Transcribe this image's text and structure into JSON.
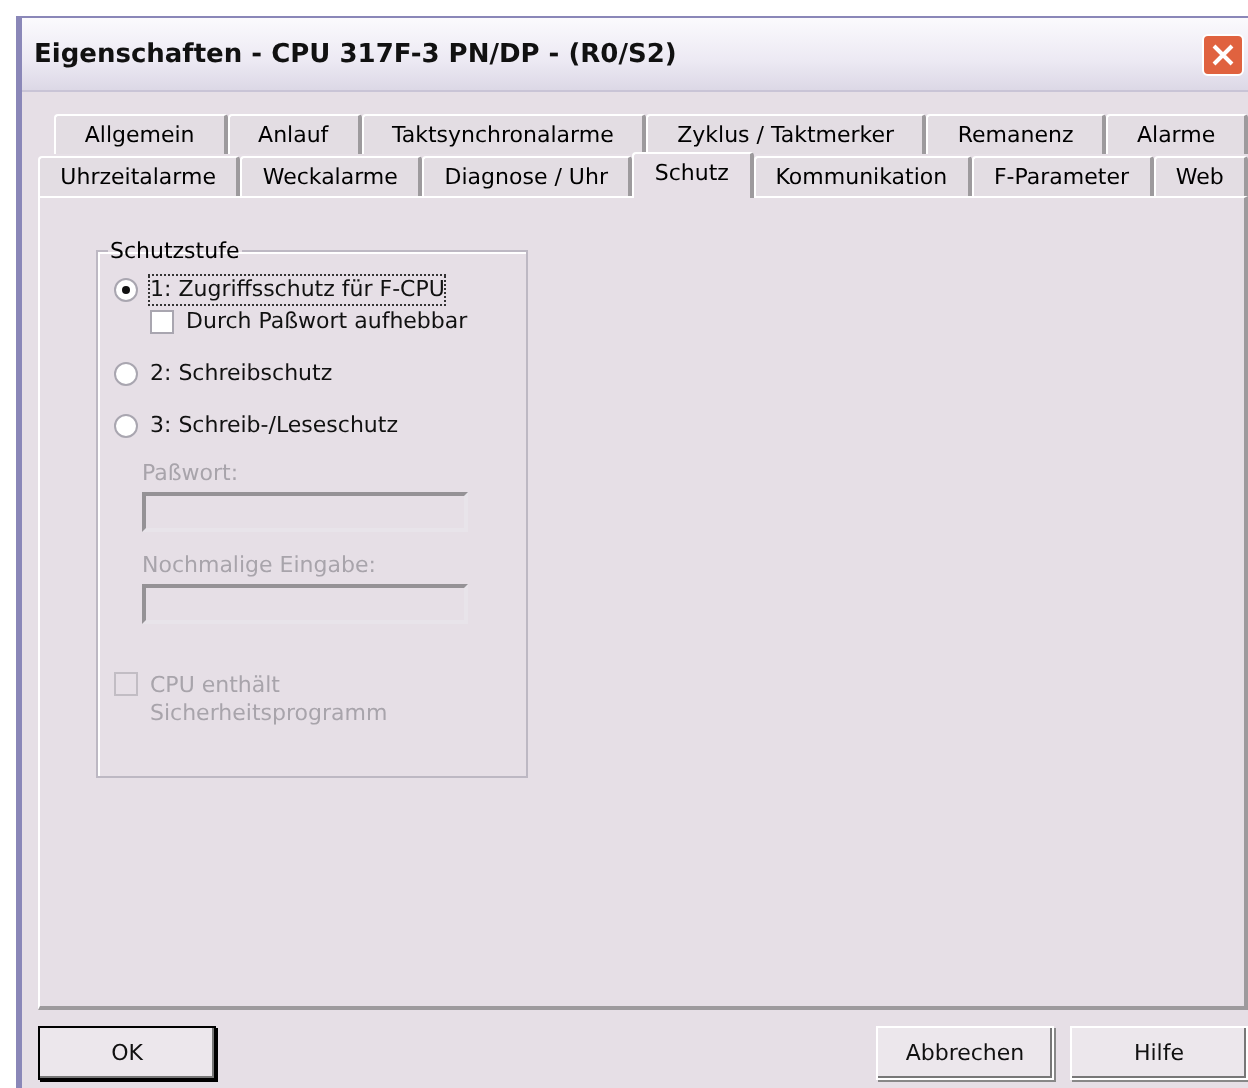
{
  "window": {
    "title": "Eigenschaften - CPU 317F-3 PN/DP - (R0/S2)"
  },
  "tab_rows": [
    {
      "tabs": [
        {
          "label": "Allgemein",
          "selected": false
        },
        {
          "label": "Anlauf",
          "selected": false
        },
        {
          "label": "Taktsynchronalarme",
          "selected": false
        },
        {
          "label": "Zyklus / Taktmerker",
          "selected": false
        },
        {
          "label": "Remanenz",
          "selected": false
        },
        {
          "label": "Alarme",
          "selected": false
        }
      ]
    },
    {
      "tabs": [
        {
          "label": "Uhrzeitalarme",
          "selected": false
        },
        {
          "label": "Weckalarme",
          "selected": false
        },
        {
          "label": "Diagnose / Uhr",
          "selected": false
        },
        {
          "label": "Schutz",
          "selected": true
        },
        {
          "label": "Kommunikation",
          "selected": false
        },
        {
          "label": "F-Parameter",
          "selected": false
        },
        {
          "label": "Web",
          "selected": false
        }
      ]
    }
  ],
  "group": {
    "title": "Schutzstufe",
    "options": [
      {
        "label": "1: Zugriffsschutz für F-CPU",
        "selected": true,
        "focused": true,
        "sub_checkbox": {
          "label": "Durch Paßwort aufhebbar",
          "checked": false,
          "disabled": false
        }
      },
      {
        "label": "2: Schreibschutz",
        "selected": false,
        "focused": false
      },
      {
        "label": "3: Schreib-/Leseschutz",
        "selected": false,
        "focused": false
      }
    ],
    "fields": [
      {
        "label": "Paßwort:",
        "disabled": true
      },
      {
        "label": "Nochmalige Eingabe:",
        "disabled": true
      }
    ],
    "checkbox": {
      "label": "CPU enthält Sicherheitsprogramm",
      "checked": false,
      "disabled": true
    }
  },
  "buttons": [
    {
      "label": "OK",
      "default": true
    },
    {
      "label": "Abbrechen",
      "default": false
    },
    {
      "label": "Hilfe",
      "default": false
    }
  ]
}
